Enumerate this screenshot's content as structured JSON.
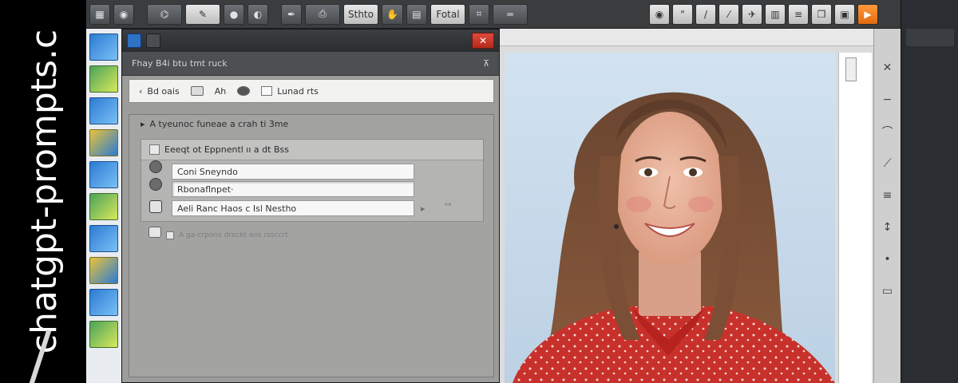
{
  "watermark": {
    "text": "chatgpt-prompts.c"
  },
  "toolbar": {
    "buttons": [
      "",
      "",
      "",
      "",
      "",
      "",
      "",
      "Sthto",
      "",
      "",
      "Fotal"
    ],
    "right_icons": [
      "",
      "",
      "",
      "",
      "",
      "",
      "",
      "",
      "",
      "",
      ""
    ]
  },
  "right_rail": {
    "tab_label": ""
  },
  "dialog": {
    "title": "",
    "close": "✕",
    "subbar_text": "Fhay B4i btu tmt ruck",
    "pin": "⊼",
    "nav": {
      "item1": "Bd oais",
      "item2": "",
      "item3": "Ah",
      "item4": "",
      "item5": "Lunad rts"
    },
    "group_title": "A tyeunoc funeae a crah ti 3me",
    "section_title": "Eeeqt ot Eppnentl ıı a dt Bss",
    "fields": {
      "f1": "Coni Sneyndo",
      "f2": "Rbonaflnpet·",
      "f3": "Aeli Ranc Haos c Isl Nestho"
    },
    "field_arrow": "▸",
    "field_value": "ᵒᵃ",
    "hint": "A ga-crpons dreckt eos rssccrt"
  },
  "colors": {
    "toolbar_bg": "#3a3c3e",
    "dialog_bg": "#5e6063",
    "close_red": "#d33a2c",
    "accent_orange": "#f07d22",
    "watermark_bg": "#000000"
  }
}
